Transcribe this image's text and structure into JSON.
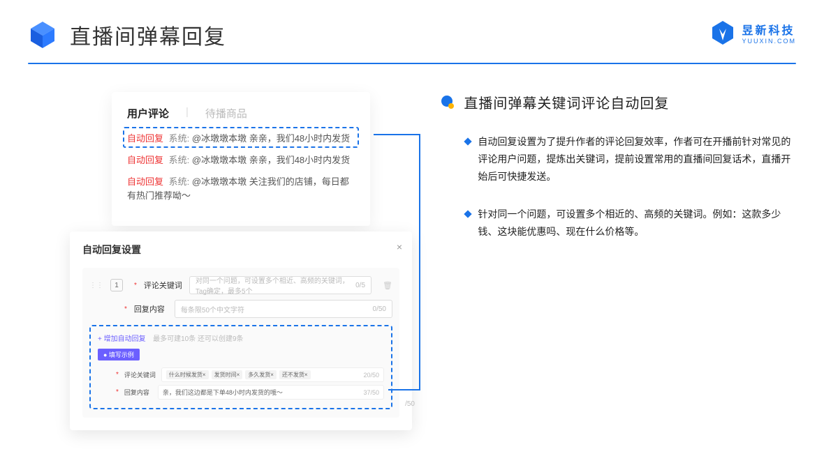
{
  "header": {
    "title": "直播间弹幕回复"
  },
  "brand": {
    "name": "昱新科技",
    "sub": "YUUXIN.COM"
  },
  "tabs": {
    "active": "用户评论",
    "inactive": "待播商品"
  },
  "messages": {
    "m1_tag": "自动回复",
    "m1_sys": "系统:",
    "m1": "@冰墩墩本墩 亲亲，我们48小时内发货",
    "m2_tag": "自动回复",
    "m2_sys": "系统:",
    "m2": "@冰墩墩本墩 亲亲，我们48小时内发货",
    "m3_tag": "自动回复",
    "m3_sys": "系统:",
    "m3": "@冰墩墩本墩 关注我们的店铺，每日都有热门推荐呦～"
  },
  "settings": {
    "title": "自动回复设置",
    "close": "×",
    "num": "1",
    "label_keyword": "评论关键词",
    "placeholder_keyword": "对同一个问题，可设置多个相近、高频的关键词，Tag确定，最多5个",
    "counter_kw": "0/5",
    "label_content": "回复内容",
    "placeholder_content": "每条限50个中文字符",
    "counter_ct": "0/50",
    "add_link": "+ 增加自动回复",
    "add_note": "最多可建10条 还可以创建9条",
    "example_badge": "● 填写示例",
    "ex_label_kw": "评论关键词",
    "chips": [
      "什么时候发货×",
      "发货时间×",
      "多久发货×",
      "还不发货×"
    ],
    "ex_counter_kw": "20/50",
    "ex_label_ct": "回复内容",
    "ex_content": "亲，我们这边都是下单48小时内发货的哦～",
    "ex_counter_ct": "37/50",
    "outside_counter": "/50"
  },
  "right": {
    "title": "直播间弹幕关键词评论自动回复",
    "b1": "自动回复设置为了提升作者的评论回复效率，作者可在开播前针对常见的评论用户问题，提炼出关键词，提前设置常用的直播间回复话术，直播开始后可快捷发送。",
    "b2": "针对同一个问题，可设置多个相近的、高频的关键词。例如：这款多少钱、这块能优惠吗、现在什么价格等。"
  }
}
